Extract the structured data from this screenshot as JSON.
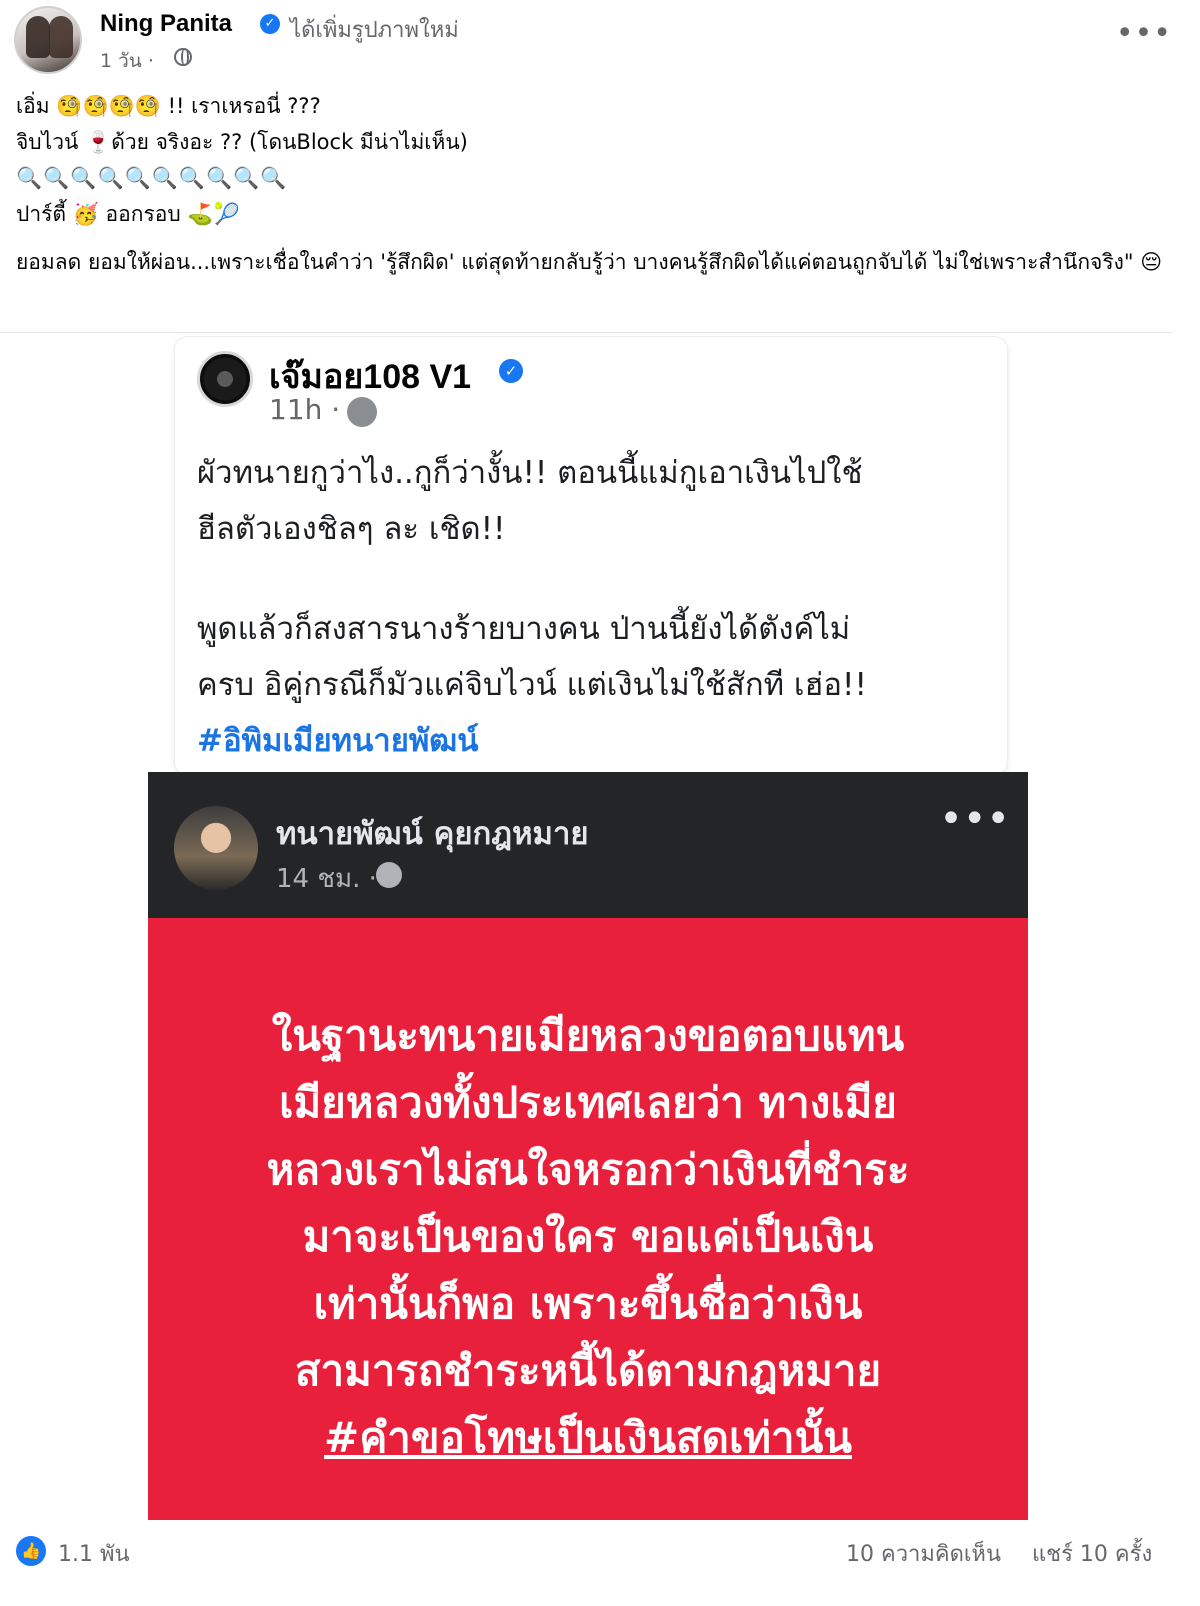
{
  "post": {
    "author": "Ning Panita",
    "action": "ได้เพิ่มรูปภาพใหม่",
    "time": "1 วัน ·",
    "more": "•••",
    "caption": {
      "line1": "เอิ่ม 🧐🧐🧐🧐 !! เราเหรอนี่ ???",
      "line2_a": "จิบไวน์ ",
      "line2_wine": "🍷",
      "line2_b": "ด้วย จริงอะ ?? (โดนBlock มีน่าไม่เห็น)",
      "line3": "🔍🔍🔍🔍🔍🔍🔍🔍🔍🔍",
      "line4": "ปาร์ตี้ 🥳 ออกรอบ ⛳🎾",
      "line5": "ยอมลด ยอมให้ผ่อน...เพราะเชื่อในคำว่า 'รู้สึกผิด' แต่สุดท้ายกลับรู้ว่า บางคนรู้สึกผิดได้แค่ตอนถูกจับได้ ไม่ใช่เพราะสำนึกจริง\" 😔"
    }
  },
  "shot1": {
    "name": "เจ๊มอย108 V1",
    "time": "11h ·",
    "line1": "ผัวทนายกูว่าไง..กูก็ว่างั้น!! ตอนนี้แม่กูเอาเงินไปใช้",
    "line2": "ฮีลตัวเองชิลๆ ละ เชิด!!",
    "line3": "พูดแล้วก็สงสารนางร้ายบางคน ป่านนี้ยังได้ตังค์ไม่",
    "line4": "ครบ อิคู่กรณีก็มัวแค่จิบไวน์ แต่เงินไม่ใช้สักที เฮ่อ!!",
    "tag": "#อิพิมเมียทนายพัฒน์"
  },
  "shot2": {
    "name": "ทนายพัฒน์ คุยกฎหมาย",
    "time": "14 ชม. ·",
    "more": "•••",
    "lines": [
      "ในฐานะทนายเมียหลวงขอตอบแทน",
      "เมียหลวงทั้งประเทศเลยว่า ทางเมีย",
      "หลวงเราไม่สนใจหรอกว่าเงินที่ชำระ",
      "มาจะเป็นของใคร ขอแค่เป็นเงิน",
      "เท่านั้นก็พอ เพราะขึ้นชื่อว่าเงิน",
      "สามารถชำระหนี้ได้ตามกฎหมาย"
    ],
    "tag": "#คำขอโทษเป็นเงินสดเท่านั้น"
  },
  "footer": {
    "likes": "1.1 พัน",
    "comments": "10 ความคิดเห็น",
    "shares": "แชร์ 10 ครั้ง"
  },
  "colors": {
    "accent": "#1877f2",
    "shot2_background": "#e8203b",
    "shot2_header": "#242526",
    "hashtag": "#1b74e4"
  },
  "icons": [
    "verified-badge-icon",
    "globe-icon",
    "more-icon",
    "like-icon"
  ]
}
